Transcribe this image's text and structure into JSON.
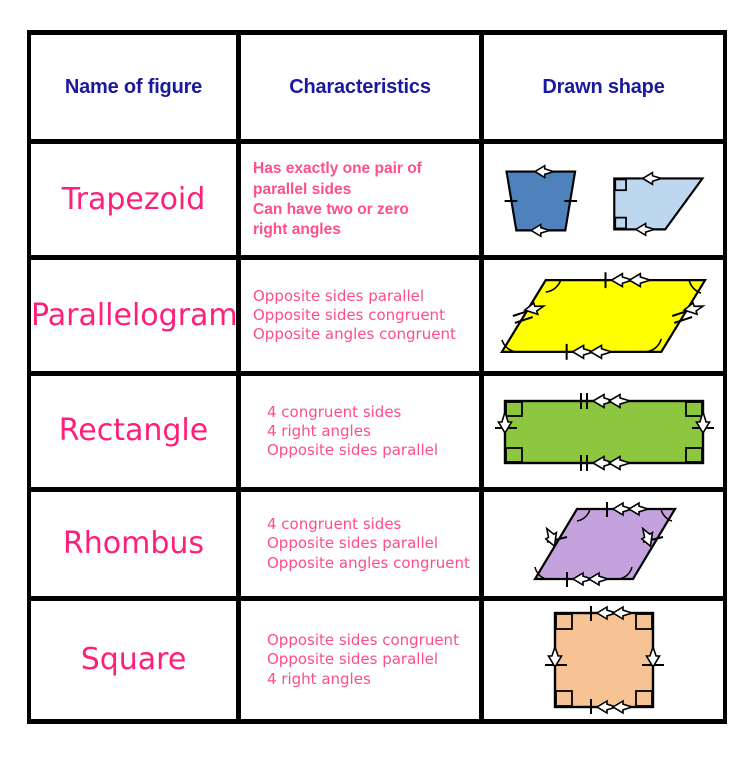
{
  "title": "Quadrilaterals reference table",
  "header": {
    "col1": "Name of figure",
    "col2": "Characteristics",
    "col3": "Drawn shape"
  },
  "colors": {
    "header_text": "#1a1a9c",
    "figure_name": "#ff1f7a",
    "characteristic_text": "#ff4d88",
    "border": "#000000",
    "background": "#ffffff",
    "trapezoid_dark": "#4f81bd",
    "trapezoid_light": "#bdd7ee",
    "parallelogram": "#ffff00",
    "rectangle": "#8dc63f",
    "rhombus": "#c3a2dd",
    "square": "#f7c294"
  },
  "rows": [
    {
      "name": "Trapezoid",
      "characteristics": [
        "Has exactly one pair of",
        "parallel sides",
        "Can have two or zero",
        "right angles"
      ],
      "shapes": [
        {
          "kind": "isosceles-trapezoid",
          "fill": "#4f81bd",
          "marks": [
            "single-arrow-top",
            "single-arrow-bottom",
            "tick-left-leg",
            "tick-right-leg"
          ]
        },
        {
          "kind": "right-trapezoid",
          "fill": "#bdd7ee",
          "marks": [
            "single-arrow-top",
            "single-arrow-bottom",
            "right-angle-upper-left",
            "right-angle-lower-left"
          ]
        }
      ]
    },
    {
      "name": "Parallelogram",
      "characteristics": [
        "Opposite sides parallel",
        "Opposite sides congruent",
        "Opposite angles congruent"
      ],
      "shapes": [
        {
          "kind": "parallelogram",
          "fill": "#ffff00",
          "marks": [
            "tick-and-double-arrow-top",
            "tick-and-double-arrow-bottom",
            "double-tick-and-arrow-left",
            "double-tick-and-arrow-right",
            "angle-arcs-4"
          ]
        }
      ]
    },
    {
      "name": "Rectangle",
      "characteristics": [
        "4 congruent sides",
        "4 right angles",
        "Opposite sides parallel"
      ],
      "shapes": [
        {
          "kind": "rectangle",
          "fill": "#8dc63f",
          "marks": [
            "double-tick-double-arrow-top",
            "double-tick-double-arrow-bottom",
            "tick-and-arrow-left",
            "tick-and-arrow-right",
            "right-angle-4"
          ]
        }
      ]
    },
    {
      "name": "Rhombus",
      "characteristics": [
        "4 congruent sides",
        "Opposite sides parallel",
        "Opposite angles congruent"
      ],
      "shapes": [
        {
          "kind": "rhombus",
          "fill": "#c3a2dd",
          "marks": [
            "tick-and-double-arrow-top",
            "tick-and-double-arrow-bottom",
            "tick-and-arrow-left",
            "tick-and-arrow-right",
            "angle-arcs-4"
          ]
        }
      ]
    },
    {
      "name": "Square",
      "characteristics": [
        "Opposite sides congruent",
        "Opposite sides parallel",
        "4 right angles"
      ],
      "shapes": [
        {
          "kind": "square",
          "fill": "#f7c294",
          "marks": [
            "tick-and-double-arrow-top",
            "tick-and-double-arrow-bottom",
            "tick-and-arrow-left",
            "tick-and-arrow-right",
            "right-angle-4"
          ]
        }
      ]
    }
  ]
}
